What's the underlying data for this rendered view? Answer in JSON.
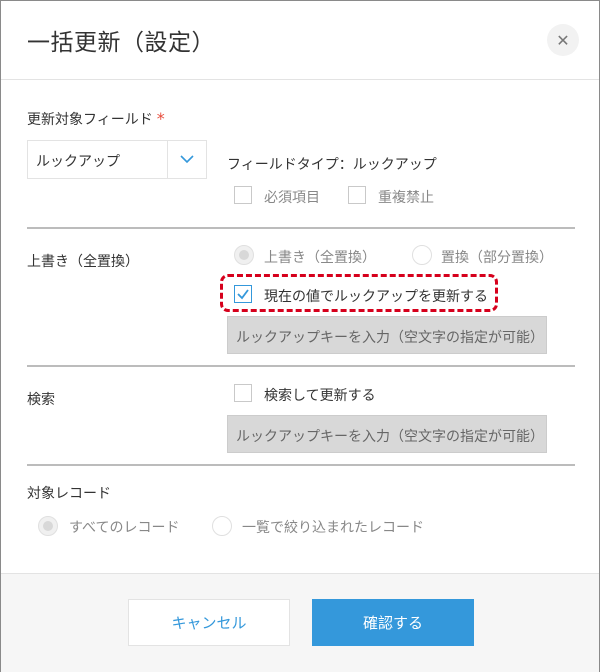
{
  "dialog": {
    "title": "一括更新（設定）",
    "close_icon": "close-icon"
  },
  "field_section": {
    "label": "更新対象フィールド",
    "required_mark": "*",
    "select_value": "ルックアップ",
    "field_type_text": "フィールドタイプ：ルックアップ",
    "required_item_label": "必須項目",
    "no_duplicate_label": "重複禁止"
  },
  "overwrite_section": {
    "label": "上書き（全置換）",
    "radio_overwrite_label": "上書き（全置換）",
    "radio_partial_label": "置換（部分置換）",
    "checkbox_update_label": "現在の値でルックアップを更新する",
    "lookup_key_placeholder": "ルックアップキーを入力（空文字の指定が可能）"
  },
  "search_section": {
    "label": "検索",
    "checkbox_search_label": "検索して更新する",
    "lookup_key_placeholder": "ルックアップキーを入力（空文字の指定が可能）"
  },
  "records_section": {
    "label": "対象レコード",
    "radio_all_label": "すべてのレコード",
    "radio_filtered_label": "一覧で絞り込まれたレコード"
  },
  "footer": {
    "cancel_label": "キャンセル",
    "confirm_label": "確認する"
  },
  "colors": {
    "accent": "#3498db",
    "required": "#e74c3c",
    "highlight": "#d6001c"
  }
}
